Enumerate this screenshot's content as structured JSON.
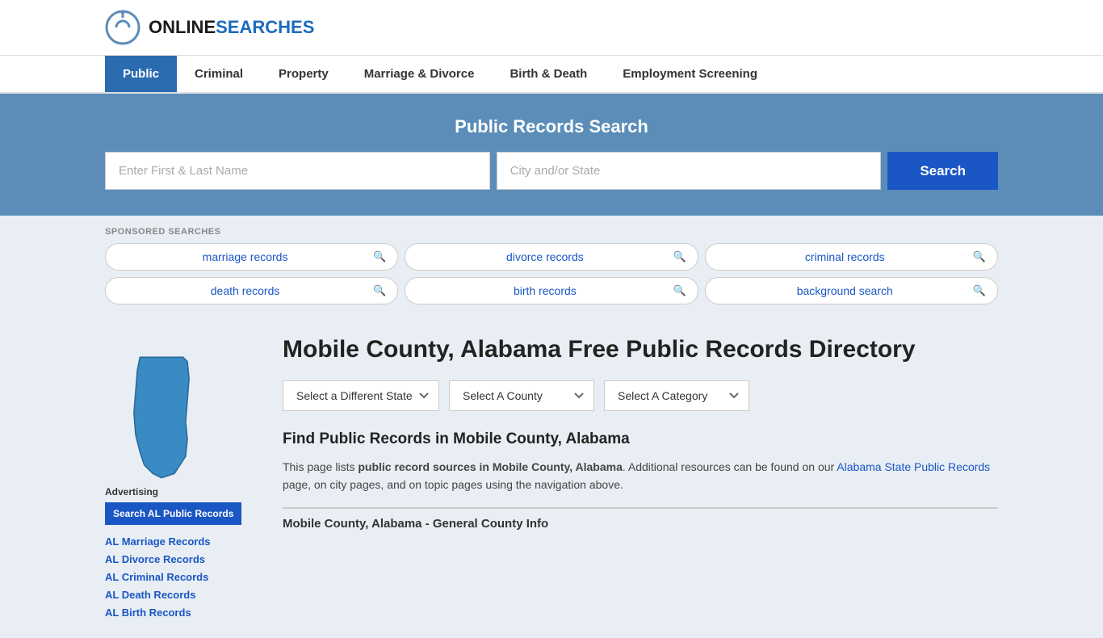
{
  "header": {
    "logo_text_online": "ONLINE",
    "logo_text_searches": "SEARCHES"
  },
  "nav": {
    "items": [
      {
        "label": "Public",
        "active": true
      },
      {
        "label": "Criminal",
        "active": false
      },
      {
        "label": "Property",
        "active": false
      },
      {
        "label": "Marriage & Divorce",
        "active": false
      },
      {
        "label": "Birth & Death",
        "active": false
      },
      {
        "label": "Employment Screening",
        "active": false
      }
    ]
  },
  "search_banner": {
    "title": "Public Records Search",
    "name_placeholder": "Enter First & Last Name",
    "location_placeholder": "City and/or State",
    "button_label": "Search"
  },
  "sponsored": {
    "label": "SPONSORED SEARCHES",
    "items": [
      {
        "label": "marriage records"
      },
      {
        "label": "divorce records"
      },
      {
        "label": "criminal records"
      },
      {
        "label": "death records"
      },
      {
        "label": "birth records"
      },
      {
        "label": "background search"
      }
    ]
  },
  "directory": {
    "title": "Mobile County, Alabama Free Public Records Directory",
    "state_dropdown": "Select a Different State",
    "county_dropdown": "Select A County",
    "category_dropdown": "Select A Category",
    "find_title": "Find Public Records in Mobile County, Alabama",
    "find_text_1": "This page lists ",
    "find_text_bold": "public record sources in Mobile County, Alabama",
    "find_text_2": ". Additional resources can be found on our ",
    "find_link": "Alabama State Public Records",
    "find_text_3": " page, on city pages, and on topic pages using the navigation above.",
    "county_info_title": "Mobile County, Alabama - General County Info"
  },
  "sidebar": {
    "ad_label": "Advertising",
    "ad_button": "Search AL Public Records",
    "links": [
      {
        "label": "AL Marriage Records"
      },
      {
        "label": "AL Divorce Records"
      },
      {
        "label": "AL Criminal Records"
      },
      {
        "label": "AL Death Records"
      },
      {
        "label": "AL Birth Records"
      }
    ]
  }
}
